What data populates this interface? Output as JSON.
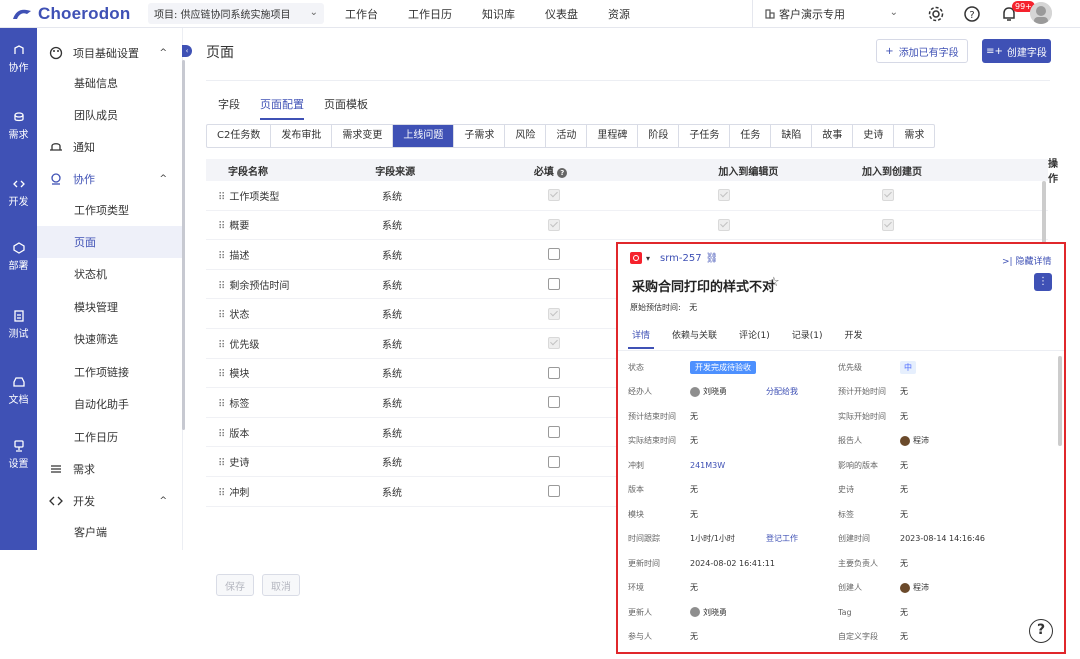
{
  "app": {
    "name": "Choerodon"
  },
  "topbar": {
    "project": "项目: 供应链协同系统实施项目",
    "nav": [
      "工作台",
      "工作日历",
      "知识库",
      "仪表盘",
      "资源"
    ],
    "org": "客户演示专用",
    "badge": "99+"
  },
  "leftbar": [
    "协作",
    "需求",
    "开发",
    "部署",
    "测试",
    "文档",
    "设置"
  ],
  "sidebar": {
    "group1": "项目基础设置",
    "items1": [
      "基础信息",
      "团队成员"
    ],
    "notify": "通知",
    "group2": "协作",
    "items2": [
      "工作项类型",
      "页面",
      "状态机",
      "模块管理",
      "快速筛选",
      "工作项链接",
      "自动化助手",
      "工作日历"
    ],
    "group3": "需求",
    "group4": "开发",
    "items4": [
      "客户端"
    ]
  },
  "main": {
    "title": "页面",
    "btn_add": "添加已有字段",
    "btn_create": "创建字段",
    "tabs": [
      "字段",
      "页面配置",
      "页面模板"
    ],
    "issue_types": [
      "C2任务数",
      "发布审批",
      "需求变更",
      "上线问题",
      "子需求",
      "风险",
      "活动",
      "里程碑",
      "阶段",
      "子任务",
      "任务",
      "缺陷",
      "故事",
      "史诗",
      "需求"
    ],
    "columns": [
      "字段名称",
      "字段来源",
      "必填",
      "加入到编辑页",
      "加入到创建页",
      "操作"
    ],
    "rows": [
      {
        "name": "工作项类型",
        "source": "系统"
      },
      {
        "name": "概要",
        "source": "系统"
      },
      {
        "name": "描述",
        "source": "系统"
      },
      {
        "name": "剩余预估时间",
        "source": "系统"
      },
      {
        "name": "状态",
        "source": "系统"
      },
      {
        "name": "优先级",
        "source": "系统"
      },
      {
        "name": "模块",
        "source": "系统"
      },
      {
        "name": "标签",
        "source": "系统"
      },
      {
        "name": "版本",
        "source": "系统"
      },
      {
        "name": "史诗",
        "source": "系统"
      },
      {
        "name": "冲刺",
        "source": "系统"
      }
    ],
    "save": "保存",
    "cancel": "取消"
  },
  "detail": {
    "id": "srm-257",
    "hide": "隐藏详情",
    "title": "采购合同打印的样式不对",
    "est_label": "原始预估时间:",
    "est_value": "无",
    "tabs": [
      "详情",
      "依赖与关联",
      "评论(1)",
      "记录(1)",
      "开发"
    ],
    "fields": {
      "status_l": "状态",
      "status_v": "开发完成待验收",
      "priority_l": "优先级",
      "priority_v": "中",
      "handler_l": "经办人",
      "handler_v": "刘晓勇",
      "assign": "分配给我",
      "plan_start_l": "预计开始时间",
      "plan_start_v": "无",
      "plan_end_l": "预计结束时间",
      "plan_end_v": "无",
      "act_start_l": "实际开始时间",
      "act_start_v": "无",
      "act_end_l": "实际结束时间",
      "act_end_v": "无",
      "reporter_l": "报告人",
      "reporter_v": "程沛",
      "sprint_l": "冲刺",
      "sprint_v": "241M3W",
      "influence_l": "影响的版本",
      "influence_v": "无",
      "version_l": "版本",
      "version_v": "无",
      "epic_l": "史诗",
      "epic_v": "无",
      "module_l": "模块",
      "module_v": "无",
      "label_l": "标签",
      "label_v": "无",
      "time_l": "时间跟踪",
      "time_v": "1小时/1小时",
      "log": "登记工作",
      "created_l": "创建时间",
      "created_v": "2023-08-14 14:16:46",
      "updated_l": "更新时间",
      "updated_v": "2024-08-02 16:41:11",
      "owner_l": "主要负责人",
      "owner_v": "无",
      "env_l": "环境",
      "env_v": "无",
      "creator_l": "创建人",
      "creator_v": "程沛",
      "updater_l": "更新人",
      "updater_v": "刘晓勇",
      "tag_l": "Tag",
      "tag_v": "无",
      "participant_l": "参与人",
      "participant_v": "无",
      "custom_l": "自定义字段",
      "custom_v": "无"
    }
  },
  "help": "?",
  "colors": {
    "accent": "#3f51b5",
    "highlight_border": "#e0272b"
  }
}
